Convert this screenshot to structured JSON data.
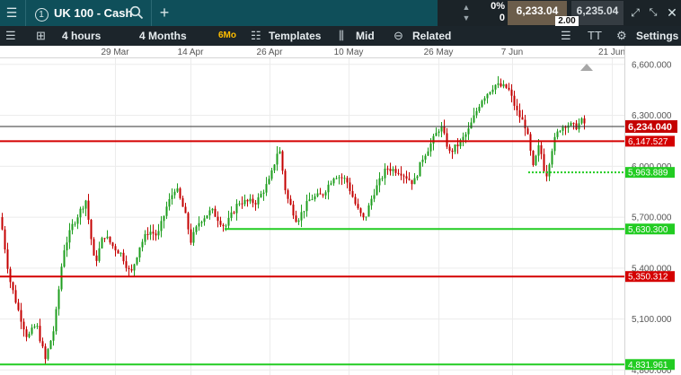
{
  "topbar": {
    "info_icon": "1",
    "title": "UK 100 - Cash",
    "change_pct": "0%",
    "change_points": "0",
    "sell_price": "6,233.04",
    "spread": "2.00",
    "buy_price": "6,235.04"
  },
  "toolbar": {
    "interval": "4 hours",
    "range": "4 Months",
    "range_badge": "6Mo",
    "templates_label": "Templates",
    "price_type": "Mid",
    "related_label": "Related",
    "font_icon_label": "TT",
    "settings_label": "Settings"
  },
  "chart_data": {
    "type": "candlestick",
    "instrument": "UK 100 - Cash",
    "x_tick_labels": [
      "29 Mar",
      "14 Apr",
      "26 Apr",
      "10 May",
      "26 May",
      "7 Jun",
      "21 Jun"
    ],
    "y_axis_labels": [
      "6,600.000",
      "6,300.000",
      "6,000.000",
      "5,700.000",
      "5,400.000",
      "5,100.000",
      "4,800.000"
    ],
    "y_tick_values": [
      6600,
      6300,
      6000,
      5700,
      5400,
      5100,
      4800
    ],
    "ylim": [
      4770,
      6710
    ],
    "grid": true,
    "current_price": {
      "value": 6234.04,
      "label": "6,234.040"
    },
    "horizontal_lines": [
      {
        "value": 6147.527,
        "label": "6,147.527",
        "color": "#d40000",
        "style": "solid"
      },
      {
        "value": 5963.889,
        "label": "5,963.889",
        "color": "#22cc22",
        "style": "dotted"
      },
      {
        "value": 5630.3,
        "label": "5,630.300",
        "color": "#22cc22",
        "style": "solid"
      },
      {
        "value": 5350.312,
        "label": "5,350.312",
        "color": "#d40000",
        "style": "solid"
      },
      {
        "value": 4831.961,
        "label": "4,831.961",
        "color": "#22cc22",
        "style": "solid"
      }
    ],
    "price_path": [
      [
        0,
        5700
      ],
      [
        10,
        5340
      ],
      [
        20,
        5150
      ],
      [
        30,
        4990
      ],
      [
        40,
        5070
      ],
      [
        50,
        4860
      ],
      [
        60,
        5050
      ],
      [
        70,
        5500
      ],
      [
        80,
        5650
      ],
      [
        95,
        5800
      ],
      [
        105,
        5420
      ],
      [
        115,
        5600
      ],
      [
        125,
        5530
      ],
      [
        135,
        5480
      ],
      [
        145,
        5360
      ],
      [
        155,
        5530
      ],
      [
        165,
        5620
      ],
      [
        175,
        5590
      ],
      [
        185,
        5760
      ],
      [
        195,
        5880
      ],
      [
        205,
        5730
      ],
      [
        212,
        5560
      ],
      [
        222,
        5680
      ],
      [
        235,
        5740
      ],
      [
        250,
        5640
      ],
      [
        265,
        5790
      ],
      [
        285,
        5790
      ],
      [
        300,
        5920
      ],
      [
        310,
        6120
      ],
      [
        318,
        5830
      ],
      [
        330,
        5680
      ],
      [
        345,
        5810
      ],
      [
        358,
        5830
      ],
      [
        372,
        5950
      ],
      [
        385,
        5920
      ],
      [
        397,
        5750
      ],
      [
        405,
        5680
      ],
      [
        415,
        5840
      ],
      [
        430,
        5990
      ],
      [
        445,
        5970
      ],
      [
        460,
        5900
      ],
      [
        470,
        6050
      ],
      [
        480,
        6140
      ],
      [
        490,
        6240
      ],
      [
        500,
        6080
      ],
      [
        510,
        6130
      ],
      [
        520,
        6200
      ],
      [
        535,
        6390
      ],
      [
        550,
        6480
      ],
      [
        565,
        6460
      ],
      [
        575,
        6320
      ],
      [
        585,
        6230
      ],
      [
        593,
        5990
      ],
      [
        600,
        6130
      ],
      [
        607,
        5930
      ],
      [
        615,
        6130
      ],
      [
        622,
        6220
      ],
      [
        630,
        6250
      ],
      [
        640,
        6230
      ],
      [
        648,
        6270
      ],
      [
        652,
        6234
      ]
    ]
  }
}
